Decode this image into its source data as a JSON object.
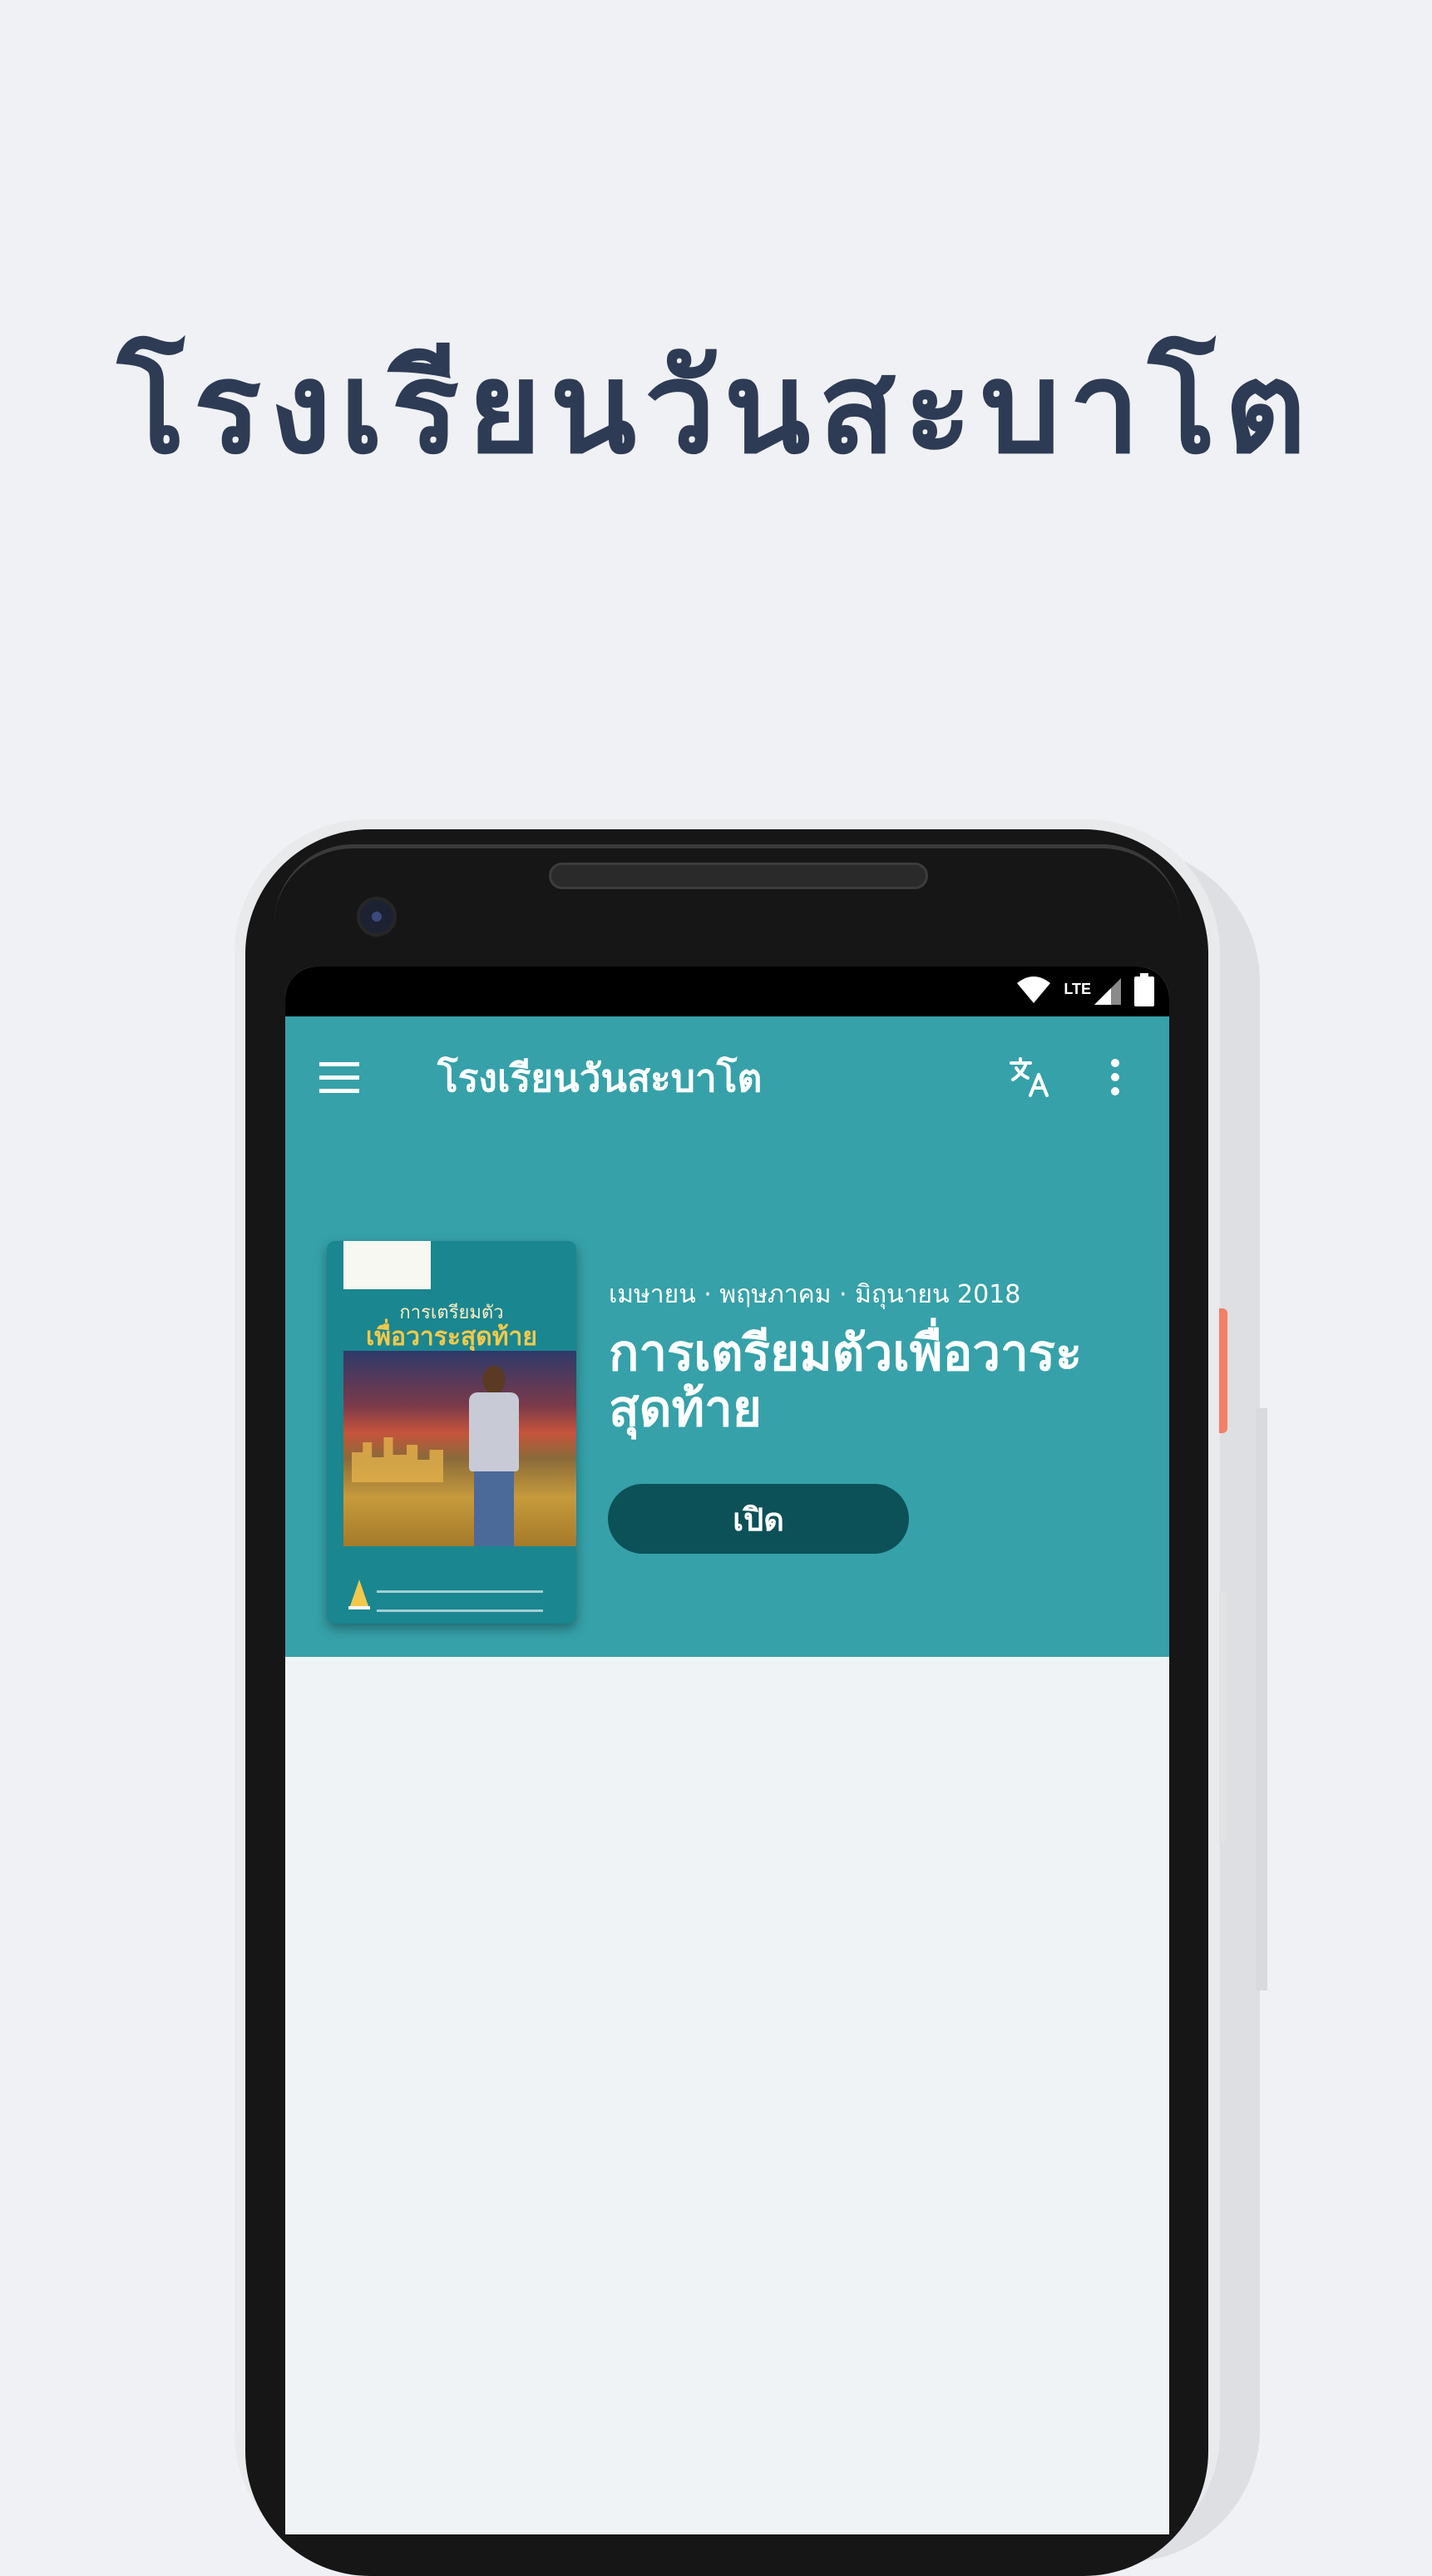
{
  "page": {
    "heading": "โรงเรียนวันสะบาโต"
  },
  "status_bar": {
    "network_label": "LTE",
    "wifi_icon": "wifi-icon",
    "signal_icon": "signal-icon",
    "battery_icon": "battery-icon"
  },
  "app_bar": {
    "title": "โรงเรียนวันสะบาโต",
    "menu_icon": "menu-icon",
    "translate_icon": "translate-icon",
    "more_icon": "more-vertical-icon"
  },
  "featured": {
    "quarter": "เมษายน · พฤษภาคม · มิถุนายน 2018",
    "title": "การเตรียมตัวเพื่อวาระสุดท้าย",
    "open_label": "เปิด",
    "cover_title_line1": "การเตรียมตัว",
    "cover_title_line2": "เพื่อวาระสุดท้าย"
  },
  "colors": {
    "background": "#eff1f4",
    "heading": "#2e3b55",
    "accent": "#36a1a9",
    "button": "#0c5158",
    "phone_body": "#161616",
    "power_button": "#f47f68"
  }
}
